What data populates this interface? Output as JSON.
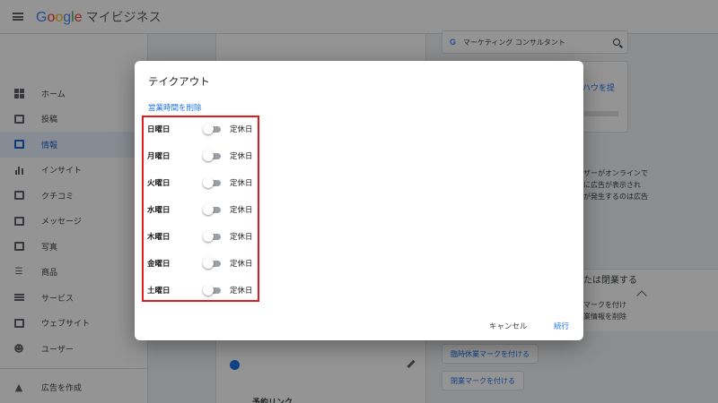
{
  "app": {
    "logo_letters": [
      {
        "ch": "G",
        "color": "#4285F4"
      },
      {
        "ch": "o",
        "color": "#EA4335"
      },
      {
        "ch": "o",
        "color": "#FBBC05"
      },
      {
        "ch": "g",
        "color": "#4285F4"
      },
      {
        "ch": "l",
        "color": "#34A853"
      },
      {
        "ch": "e",
        "color": "#EA4335"
      }
    ],
    "product": "マイビジネス"
  },
  "sidebar": {
    "items": [
      {
        "label": "ホーム",
        "icon": "dashboard-icon"
      },
      {
        "label": "投稿",
        "icon": "posts-icon"
      },
      {
        "label": "情報",
        "icon": "info-store-icon",
        "active": true
      },
      {
        "label": "インサイト",
        "icon": "insights-bar-icon"
      },
      {
        "label": "クチコミ",
        "icon": "reviews-icon"
      },
      {
        "label": "メッセージ",
        "icon": "message-icon"
      },
      {
        "label": "写真",
        "icon": "photos-icon"
      },
      {
        "label": "商品",
        "icon": "products-basket-icon"
      },
      {
        "label": "サービス",
        "icon": "services-list-icon"
      },
      {
        "label": "ウェブサイト",
        "icon": "website-icon"
      },
      {
        "label": "ユーザー",
        "icon": "users-add-icon"
      }
    ],
    "bottom_items": [
      {
        "label": "広告を作成",
        "icon": "ads-icon"
      }
    ]
  },
  "background": {
    "search_value": "マーケティング コンサルタント",
    "card_peek": "ハウを提",
    "peek_lines": [
      "ザーがオンラインで",
      "に広告が表示され",
      "が発生するのは広告"
    ],
    "section_peek": "たは閉業する",
    "section_lines": [
      "マークを付け",
      "業情報を削除"
    ],
    "temp_close_button": "臨時休業マークを付ける",
    "close_button": "閉業マークを付ける",
    "center_bottom": "予約リンク"
  },
  "dialog": {
    "title": "テイクアウト",
    "remove_hours_link": "営業時間を削除",
    "closed_label": "定休日",
    "days": [
      "日曜日",
      "月曜日",
      "火曜日",
      "水曜日",
      "木曜日",
      "金曜日",
      "土曜日"
    ],
    "cancel_label": "キャンセル",
    "continue_label": "続行",
    "highlight_color": "#E01B1B"
  }
}
